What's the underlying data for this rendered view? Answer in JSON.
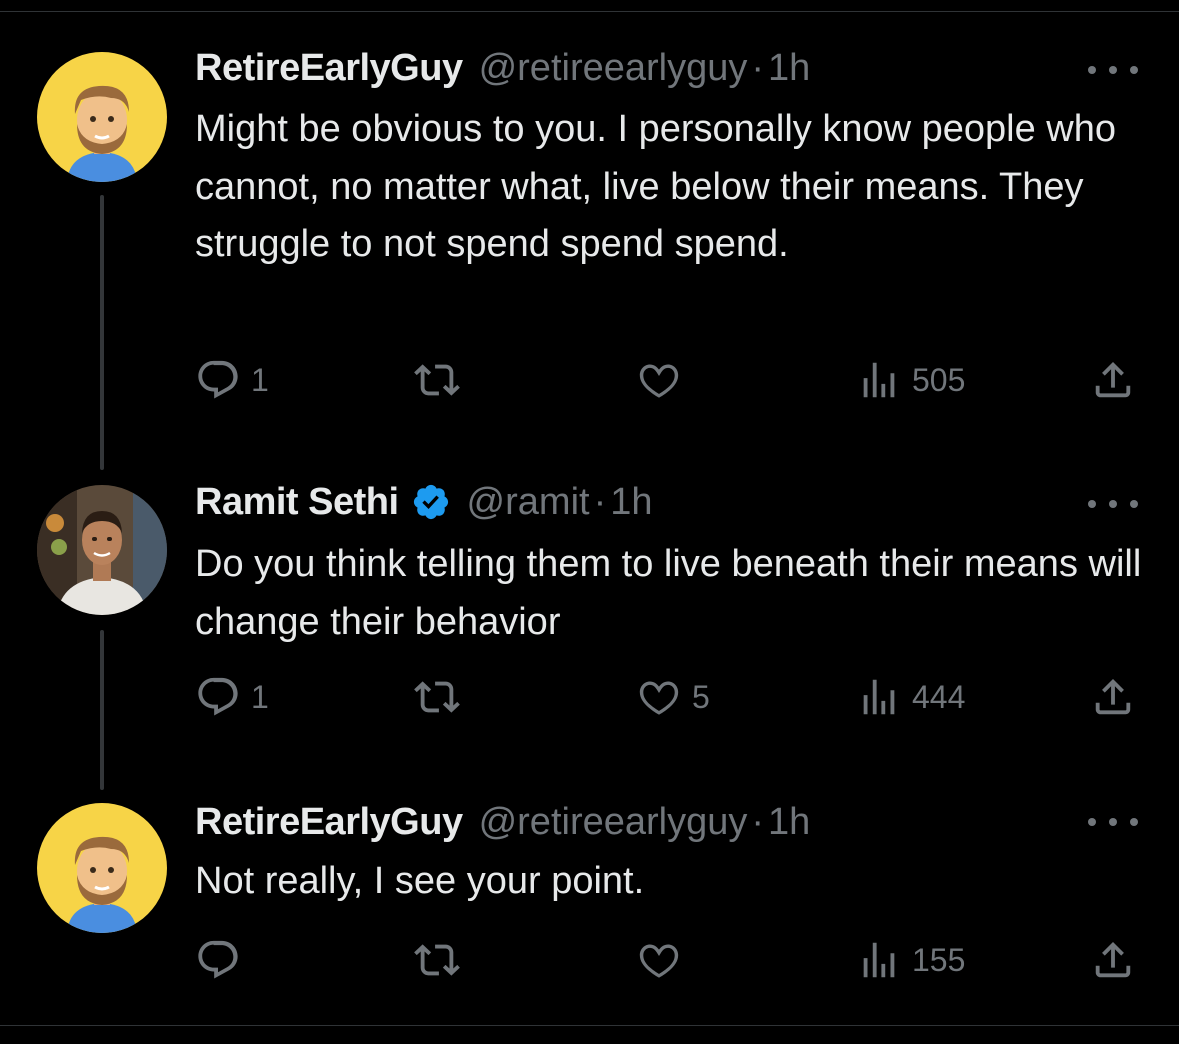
{
  "tweets": [
    {
      "name": "RetireEarlyGuy",
      "handle": "@retireearlyguy",
      "separator": "·",
      "time": "1h",
      "text": "Might be obvious to you. I personally know people who cannot, no matter what, live below their means. They struggle to not spend spend spend.",
      "replies": "1",
      "retweets": "",
      "likes": "",
      "views": "505"
    },
    {
      "name": "Ramit Sethi",
      "handle": "@ramit",
      "separator": "·",
      "time": "1h",
      "verified": true,
      "text": "Do you think telling them to live beneath their means will change their behavior",
      "replies": "1",
      "retweets": "",
      "likes": "5",
      "views": "444"
    },
    {
      "name": "RetireEarlyGuy",
      "handle": "@retireearlyguy",
      "separator": "·",
      "time": "1h",
      "text": "Not really, I see your point.",
      "replies": "",
      "retweets": "",
      "likes": "",
      "views": "155"
    }
  ],
  "colors": {
    "background": "#000000",
    "text": "#e7e9ea",
    "muted": "#71767b",
    "verified": "#1d9bf0",
    "cartoon_bg": "#f7d447"
  },
  "icons": [
    "reply-icon",
    "retweet-icon",
    "like-icon",
    "views-icon",
    "share-icon",
    "more-icon",
    "verified-badge-icon"
  ]
}
